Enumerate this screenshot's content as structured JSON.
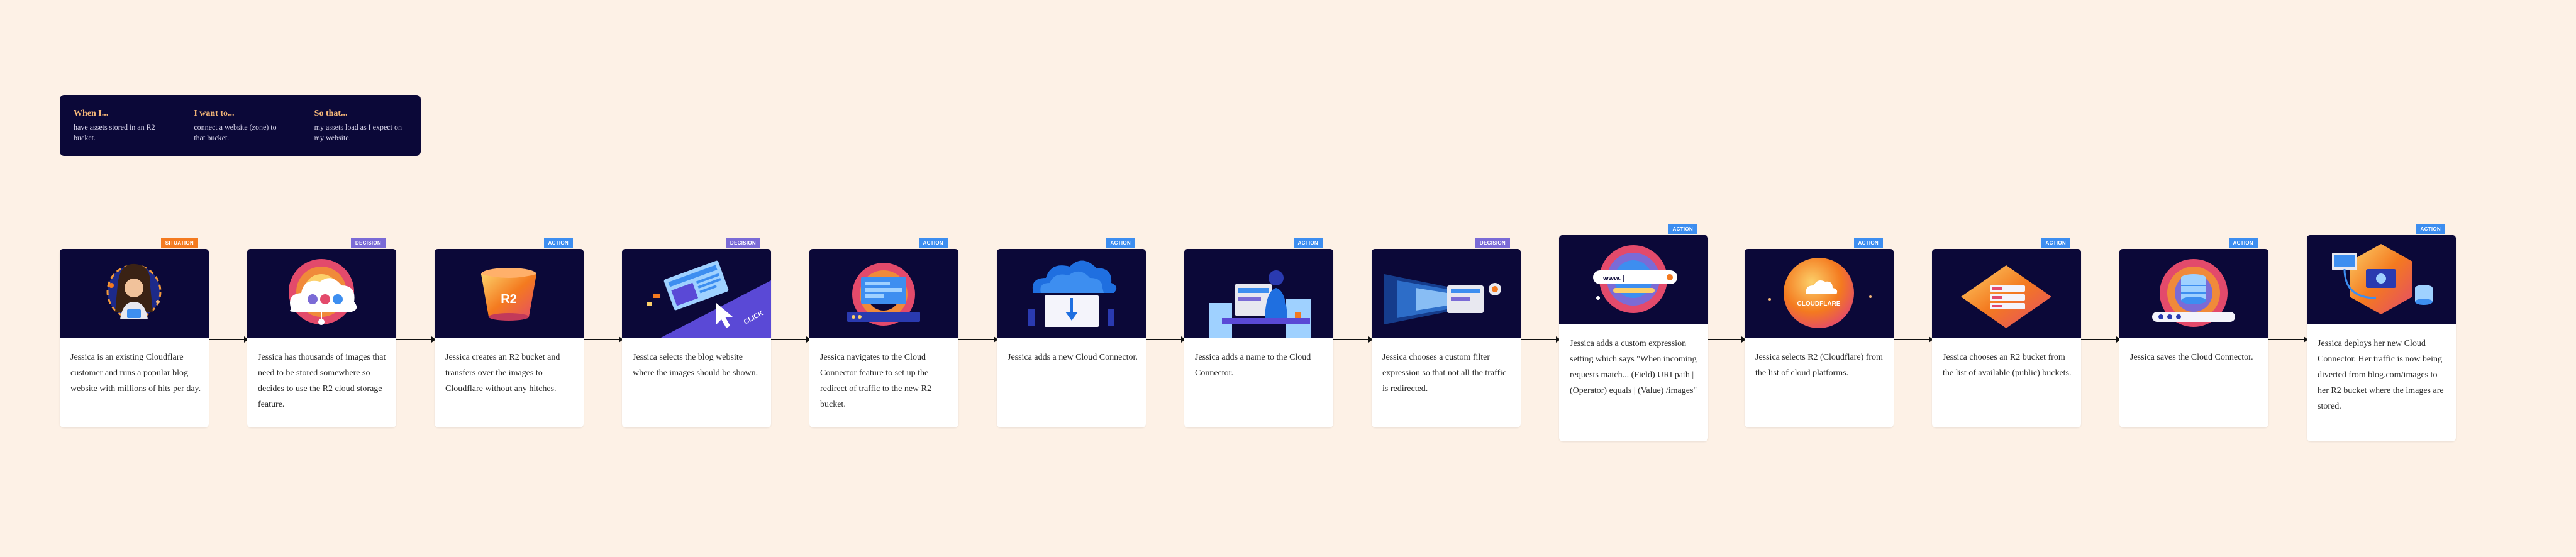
{
  "legend": [
    {
      "title": "When I...",
      "text": "have assets stored in an R2 bucket."
    },
    {
      "title": "I want to...",
      "text": "connect a website (zone) to that bucket."
    },
    {
      "title": "So that...",
      "text": "my assets load as I expect on my website."
    }
  ],
  "steps": [
    {
      "tag": "SITUATION",
      "kind": "situation",
      "text": "Jessica is an existing Cloudflare customer and runs a popular blog website with millions of hits per day."
    },
    {
      "tag": "DECISION",
      "kind": "decision",
      "text": "Jessica has thousands of images that need to be stored somewhere so decides to use the R2 cloud storage feature."
    },
    {
      "tag": "ACTION",
      "kind": "action",
      "text": "Jessica creates an R2 bucket and transfers over the images to Cloudflare without any hitches.",
      "art_text": "R2"
    },
    {
      "tag": "DECISION",
      "kind": "decision",
      "text": "Jessica selects the blog website where the images should be shown.",
      "art_text": "CLICK"
    },
    {
      "tag": "ACTION",
      "kind": "action",
      "text": "Jessica navigates to the Cloud Connector feature to set up the redirect of traffic to the new R2 bucket."
    },
    {
      "tag": "ACTION",
      "kind": "action",
      "text": "Jessica adds a new Cloud Connector."
    },
    {
      "tag": "ACTION",
      "kind": "action",
      "text": "Jessica adds a name to the Cloud Connector."
    },
    {
      "tag": "DECISION",
      "kind": "decision",
      "text": "Jessica chooses a custom filter expression so that not all the traffic is redirected."
    },
    {
      "tag": "ACTION",
      "kind": "action",
      "text": "Jessica adds a custom expression setting which says \"When incoming requests match... (Field) URI path | (Operator) equals | (Value) /images\"",
      "art_text": "www. |"
    },
    {
      "tag": "ACTION",
      "kind": "action",
      "text": "Jessica selects R2 (Cloudflare) from the list of cloud platforms.",
      "art_text": "CLOUDFLARE"
    },
    {
      "tag": "ACTION",
      "kind": "action",
      "text": "Jessica chooses an R2 bucket from the list of available (public) buckets."
    },
    {
      "tag": "ACTION",
      "kind": "action",
      "text": "Jessica saves the Cloud Connector."
    },
    {
      "tag": "ACTION",
      "kind": "action",
      "text": "Jessica deploys her new Cloud Connector. Her traffic is now being diverted from blog.com/images to her R2 bucket where the images are stored."
    }
  ]
}
